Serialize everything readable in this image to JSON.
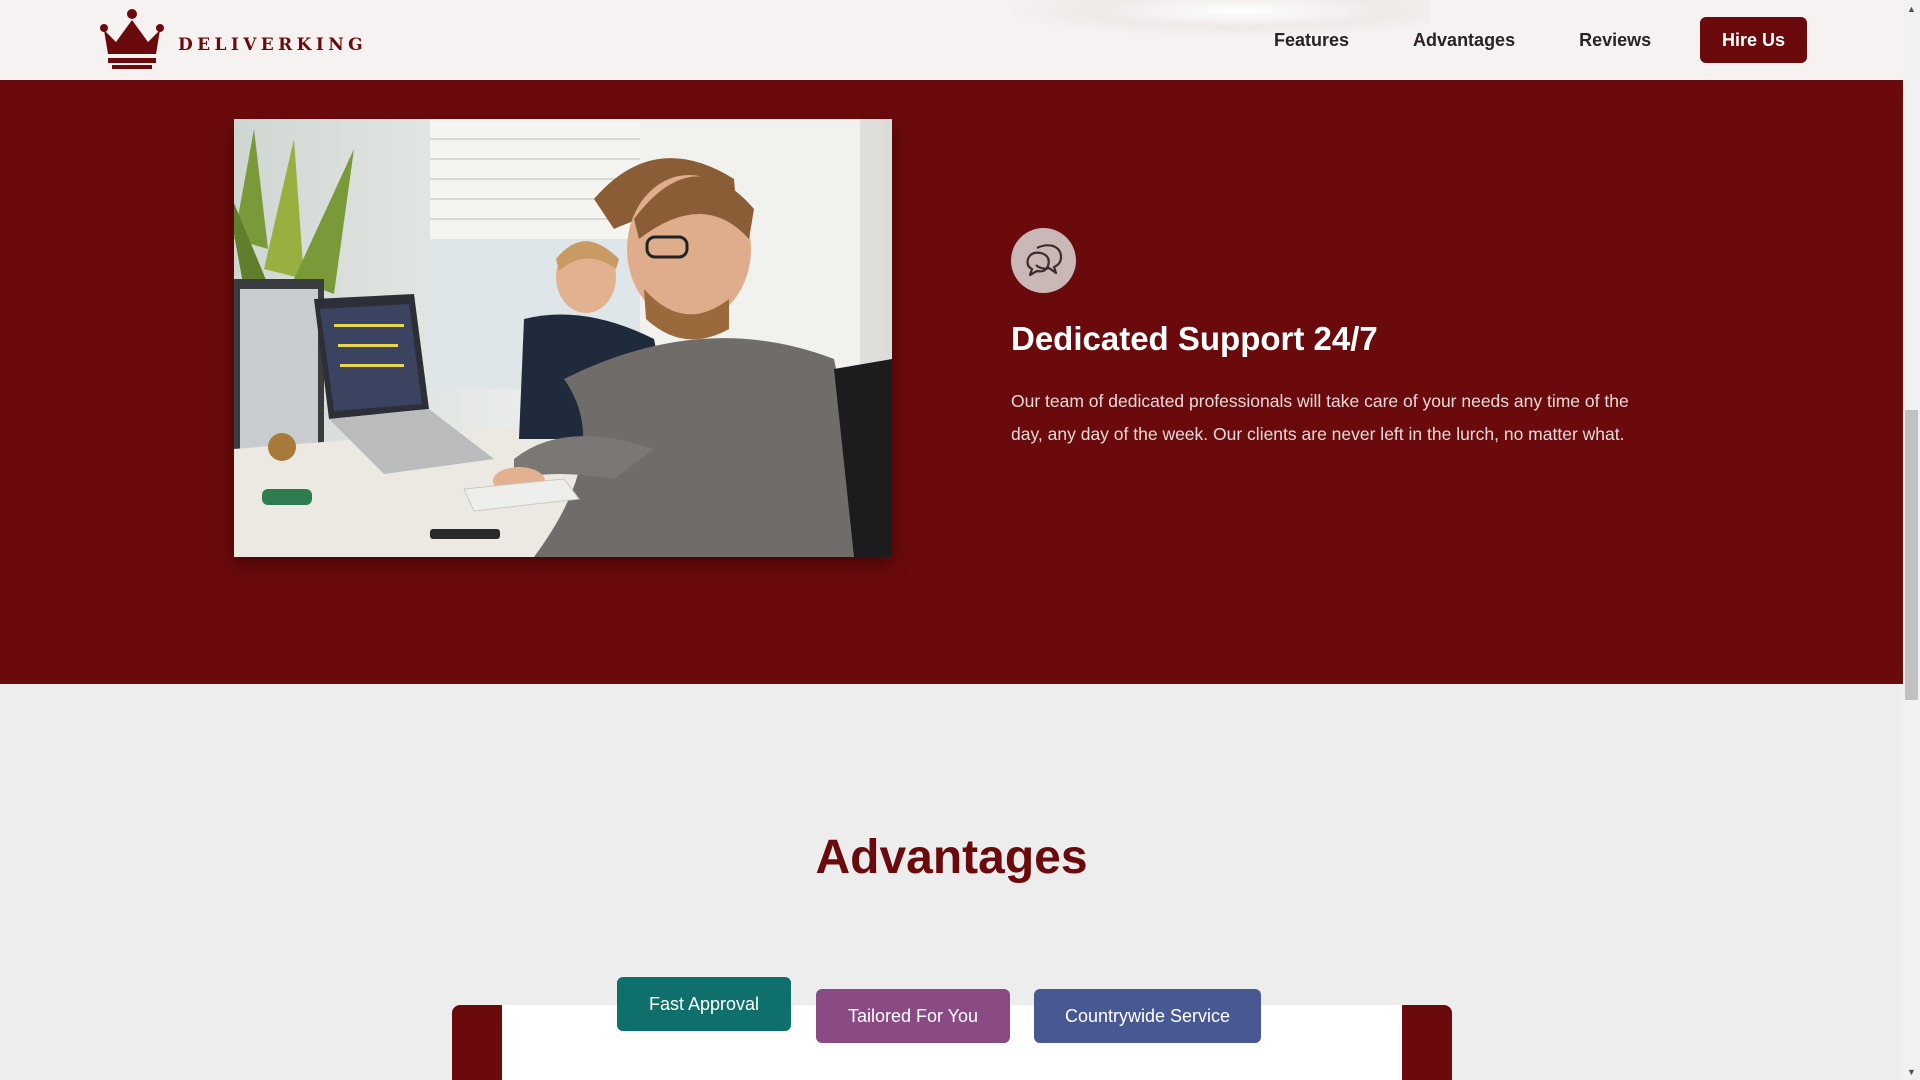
{
  "brand": {
    "name": "DELIVERKING",
    "icon": "crown-icon",
    "color": "#6b0a0c"
  },
  "nav": {
    "links": [
      "Features",
      "Advantages",
      "Reviews"
    ],
    "cta": "Hire Us"
  },
  "support": {
    "icon": "chat-bubbles-icon",
    "title": "Dedicated Support 24/7",
    "text": "Our team of dedicated professionals will take care of your needs any time of the day, any day of the week. Our clients are never left in the lurch, no matter what.",
    "image": "office-workers-photo"
  },
  "advantages": {
    "title": "Advantages",
    "tabs": [
      {
        "label": "Fast Approval",
        "color": "#0e6f6b",
        "active": true
      },
      {
        "label": "Tailored For You",
        "color": "#8a4a84",
        "active": false
      },
      {
        "label": "Countrywide Service",
        "color": "#485893",
        "active": false
      }
    ]
  },
  "colors": {
    "primary": "#6b0a0c",
    "background": "#eeeded",
    "header": "#f6f2f1"
  }
}
